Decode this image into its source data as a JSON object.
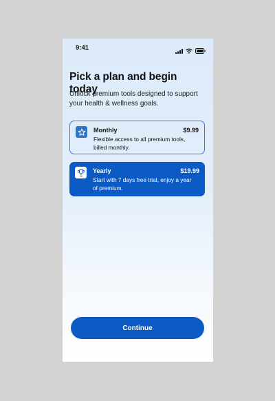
{
  "status_bar": {
    "time": "9:41",
    "icons": [
      "signal-icon",
      "wifi-icon",
      "battery-icon"
    ]
  },
  "header": {
    "title": "Pick a plan and begin today",
    "subtitle": "Unlock premium tools designed to support your health & wellness goals."
  },
  "plans": [
    {
      "name": "Monthly",
      "price": "$9.99",
      "description": "Flexible access to all premium tools, billed monthly.",
      "icon": "star-icon",
      "selected": false
    },
    {
      "name": "Yearly",
      "price": "$19.99",
      "description": "Start with 7 days free trial, enjoy a year of premium.",
      "icon": "trophy-icon",
      "selected": true
    }
  ],
  "footer": {
    "continue_label": "Continue"
  },
  "colors": {
    "primary": "#0c5bc4",
    "background_top": "#dceaf9",
    "background_bottom": "#ffffff",
    "text": "#111111"
  }
}
